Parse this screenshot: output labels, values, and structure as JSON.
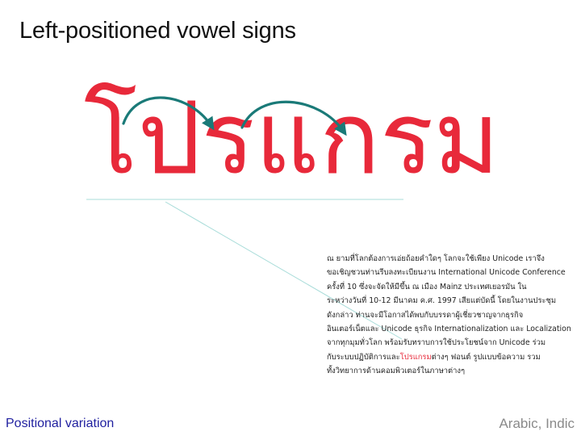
{
  "slide": {
    "title": "Left-positioned vowel signs",
    "big_word": "โปรแกรม",
    "paragraph_lines": [
      {
        "before": "ณ ยามที่โลกต้องการเอ่ยถ้อยคำใดๆ โลกจะใช้เพียง Unicode  เราจึง",
        "highlight": "",
        "after": ""
      },
      {
        "before": "ขอเชิญชวนท่านรีบลงทะเบียนงาน International Unicode Conference",
        "highlight": "",
        "after": ""
      },
      {
        "before": "ครั้งที่ 10 ซึ่งจะจัดให้มีขึ้น ณ เมือง Mainz ประเทศเยอรมัน ใน",
        "highlight": "",
        "after": ""
      },
      {
        "before": "ระหว่างวันที่ 10-12 มีนาคม ค.ศ. 1997 เสียแต่บัดนี้ โดยในงานประชุม",
        "highlight": "",
        "after": ""
      },
      {
        "before": "ดังกล่าว ท่านจะมีโอกาสได้พบกับบรรดาผู้เชี่ยวชาญจากธุรกิจ",
        "highlight": "",
        "after": ""
      },
      {
        "before": "อินเตอร์เน็ตและ Unicode ธุรกิจ Internationalization และ Localization",
        "highlight": "",
        "after": ""
      },
      {
        "before": "จากทุกมุมทั่วโลก พร้อมรับทราบการใช้ประโยชน์จาก Unicode ร่วม",
        "highlight": "",
        "after": ""
      },
      {
        "before": "กับระบบปฏิบัติการและ",
        "highlight": "โปรแกรม",
        "after": "ต่างๆ ฟอนต์ รูปแบบข้อความ รวม"
      },
      {
        "before": "ทั้งวิทยาการด้านคอมพิวเตอร์ในภาษาต่างๆ",
        "highlight": "",
        "after": ""
      }
    ],
    "footer_left": "Positional variation",
    "footer_right": "Arabic, Indic"
  },
  "colors": {
    "accent_red": "#e8293a",
    "arrow_teal": "#1a7a78",
    "guide_line": "#a8dcd9",
    "footer_blue": "#1f1f9f",
    "footer_gray": "#8a8a8a"
  }
}
